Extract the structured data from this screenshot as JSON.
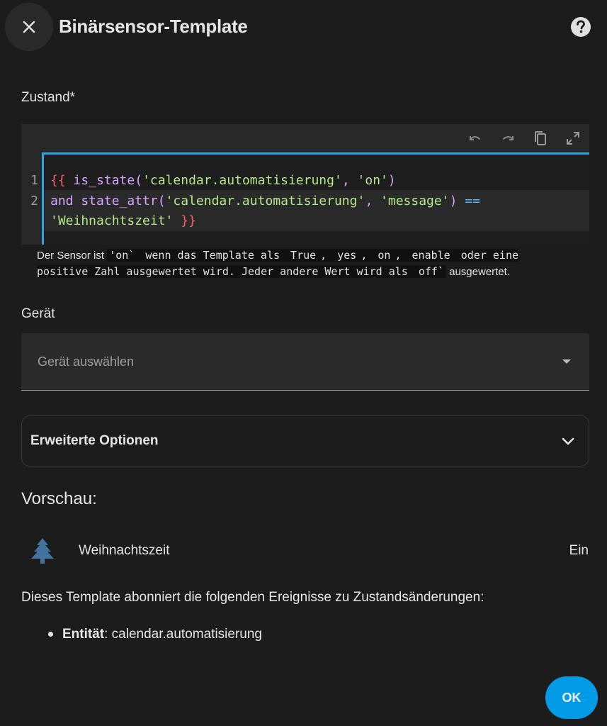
{
  "dialog": {
    "title": "Binärsensor-Template",
    "close_icon": "close-icon",
    "help_icon": "help-circle-icon"
  },
  "state_field": {
    "label": "Zustand*",
    "toolbar": [
      "undo-icon",
      "redo-icon",
      "copy-icon",
      "fullscreen-icon"
    ],
    "line_numbers": [
      "1",
      "2"
    ],
    "code": {
      "l1_open": "{{",
      "l1_fn": " is_state(",
      "l1_arg1": "'calendar.automatisierung'",
      "l1_sep": ", ",
      "l1_arg2": "'on'",
      "l1_close": ")",
      "l2_kw": "and state_attr(",
      "l2_arg1": "'calendar.automatisierung'",
      "l2_sep": ", ",
      "l2_arg2": "'message'",
      "l2_close": ") ",
      "l2_op": "==",
      "l3_str": "'Weihnachtszeit'",
      "l3_close": " }}"
    },
    "hint": {
      "p1": "Der Sensor ist ",
      "on1": "'on`",
      "p2": " wenn das Template als ",
      "v_true": "True",
      "p3": ", ",
      "v_yes": "yes",
      "p4": ", ",
      "v_on": "on",
      "p5": ", ",
      "v_enable": "enable",
      "p6": " oder eine positive Zahl ausgewertet wird. Jeder andere Wert wird als ",
      "v_off": "off`",
      "p7": " ausgewertet."
    }
  },
  "device_field": {
    "label": "Gerät",
    "placeholder": "Gerät auswählen"
  },
  "advanced": {
    "label": "Erweiterte Optionen"
  },
  "preview": {
    "title": "Vorschau:",
    "icon": "pine-tree-icon",
    "icon_color": "#44739e",
    "entity_name": "Weihnachtszeit",
    "entity_state": "Ein",
    "subscription_text": "Dieses Template abonniert die folgenden Ereignisse zu Zustandsänderungen:",
    "subscription_item_label": "Entität",
    "subscription_item_sep": ": ",
    "subscription_item_value": "calendar.automatisierung"
  },
  "actions": {
    "ok_label": "OK",
    "accent": "#039be5"
  }
}
